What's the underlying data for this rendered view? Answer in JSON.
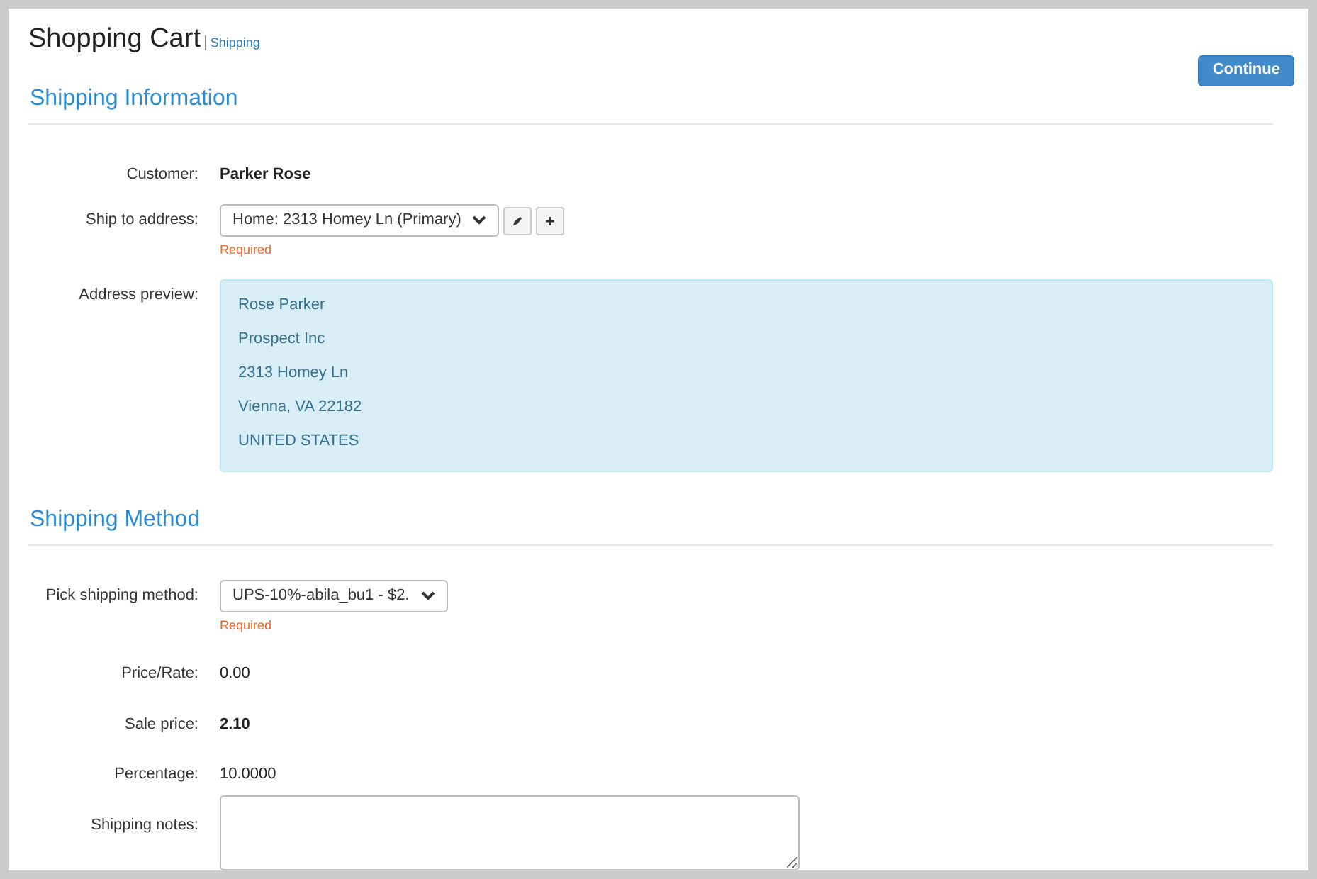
{
  "header": {
    "title": "Shopping Cart",
    "separator": "|",
    "breadcrumb": "Shipping"
  },
  "continue_button": "Continue",
  "sections": [
    {
      "title": "Shipping Information",
      "fields": [
        {
          "kind": "text",
          "label": "Customer:",
          "value": "Parker Rose",
          "bold": true
        },
        {
          "kind": "select",
          "label": "Ship to address:",
          "value": "Home: 2313 Homey Ln (Primary)",
          "hint": "Required",
          "edit_buttons": true
        },
        {
          "kind": "preview",
          "label": "Address preview:",
          "lines": [
            "Rose Parker",
            "Prospect Inc",
            "2313 Homey Ln",
            "Vienna, VA 22182",
            "UNITED STATES"
          ]
        }
      ]
    },
    {
      "title": "Shipping Method",
      "fields": [
        {
          "kind": "select",
          "label": "Pick shipping method:",
          "value": "UPS-10%-abila_bu1 - $2.",
          "hint": "Required",
          "edit_buttons": false
        },
        {
          "kind": "text",
          "label": "Price/Rate:",
          "value": "0.00",
          "bold": false
        },
        {
          "kind": "text",
          "label": "Sale price:",
          "value": "2.10",
          "bold": true
        },
        {
          "kind": "text",
          "label": "Percentage:",
          "value": "10.0000",
          "bold": false
        },
        {
          "kind": "textarea",
          "label": "Shipping notes:"
        }
      ]
    }
  ]
}
